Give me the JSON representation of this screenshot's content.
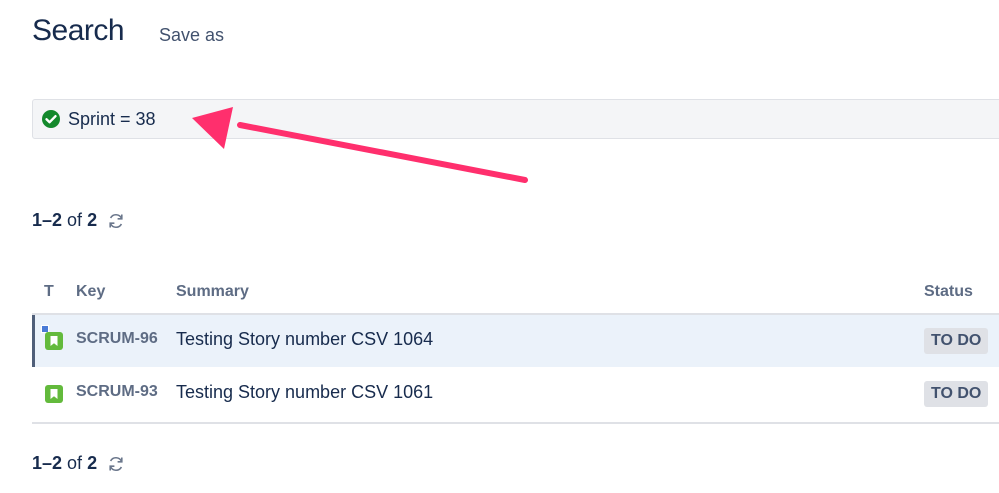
{
  "header": {
    "title": "Search",
    "save_as": "Save as"
  },
  "query": {
    "text": "Sprint = 38",
    "valid_icon": "check-circle-icon",
    "valid_color": "#14892c"
  },
  "annotation": {
    "arrow_color": "#ff2f6d"
  },
  "pager_top": {
    "range": "1–2",
    "of": "of",
    "total": "2"
  },
  "table": {
    "columns": {
      "type": "T",
      "key": "Key",
      "summary": "Summary",
      "status": "Status"
    },
    "rows": [
      {
        "key": "SCRUM-96",
        "summary": "Testing Story number CSV 1064",
        "status": "TO DO",
        "type_icon": "story-icon"
      },
      {
        "key": "SCRUM-93",
        "summary": "Testing Story number CSV 1061",
        "status": "TO DO",
        "type_icon": "story-icon"
      }
    ]
  },
  "pager_bottom": {
    "range": "1–2",
    "of": "of",
    "total": "2"
  },
  "colors": {
    "story": "#63ba3c",
    "selected_row": "#ebf2fa"
  }
}
